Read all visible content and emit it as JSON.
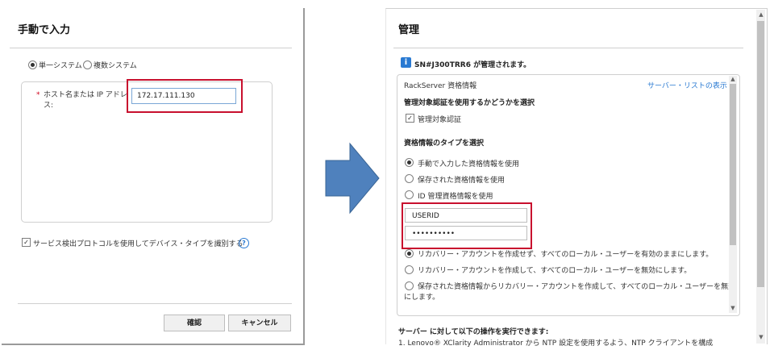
{
  "left_dialog": {
    "title": "手動で入力",
    "mode_single": "単一システム",
    "mode_multi": "複数システム",
    "host_required_mark": "*",
    "host_label": "ホスト名または IP アドレス:",
    "host_value": "172.17.111.130",
    "service_discovery_label": "サービス検出プロトコルを使用してデバイス・タイプを識別する",
    "help_glyph": "?",
    "ok_button": "確認",
    "cancel_button": "キャンセル"
  },
  "right_dialog": {
    "title": "管理",
    "info_icon_glyph": "i",
    "managed_message": "SN#J300TRR6 が管理されます。",
    "section_title": "RackServer 資格情報",
    "server_list_link": "サーバー・リストの表示",
    "managed_auth_heading": "管理対象認証を使用するかどうかを選択",
    "managed_auth_checkbox": "管理対象認証",
    "credential_type_heading": "資格情報のタイプを選択",
    "credential_options": [
      "手動で入力した資格情報を使用",
      "保存された資格情報を使用",
      "ID 管理資格情報を使用"
    ],
    "userid_value": "USERID",
    "password_value": "••••••••••",
    "recovery_options": [
      "リカバリー・アカウントを作成せず、すべてのローカル・ユーザーを有効のままにします。",
      "リカバリー・アカウントを作成して、すべてのローカル・ユーザーを無効にします。",
      "保存された資格情報からリカバリー・アカウントを作成して、すべてのローカル・ユーザーを無効",
      "にします。"
    ],
    "bottom_heading": "サーバー に対して以下の操作を実行できます:",
    "bottom_item_1": "1. Lenovo® XClarity Administrator から NTP 設定を使用するよう、NTP クライアントを構成"
  },
  "icons": {
    "arrow": "right-arrow-icon",
    "info": "info-icon",
    "help": "help-icon",
    "scroll_up": "▲",
    "scroll_down": "▼"
  },
  "colors": {
    "highlight_red": "#c8102e",
    "link_blue": "#2a7ad2",
    "arrow_blue": "#4f81bd"
  }
}
